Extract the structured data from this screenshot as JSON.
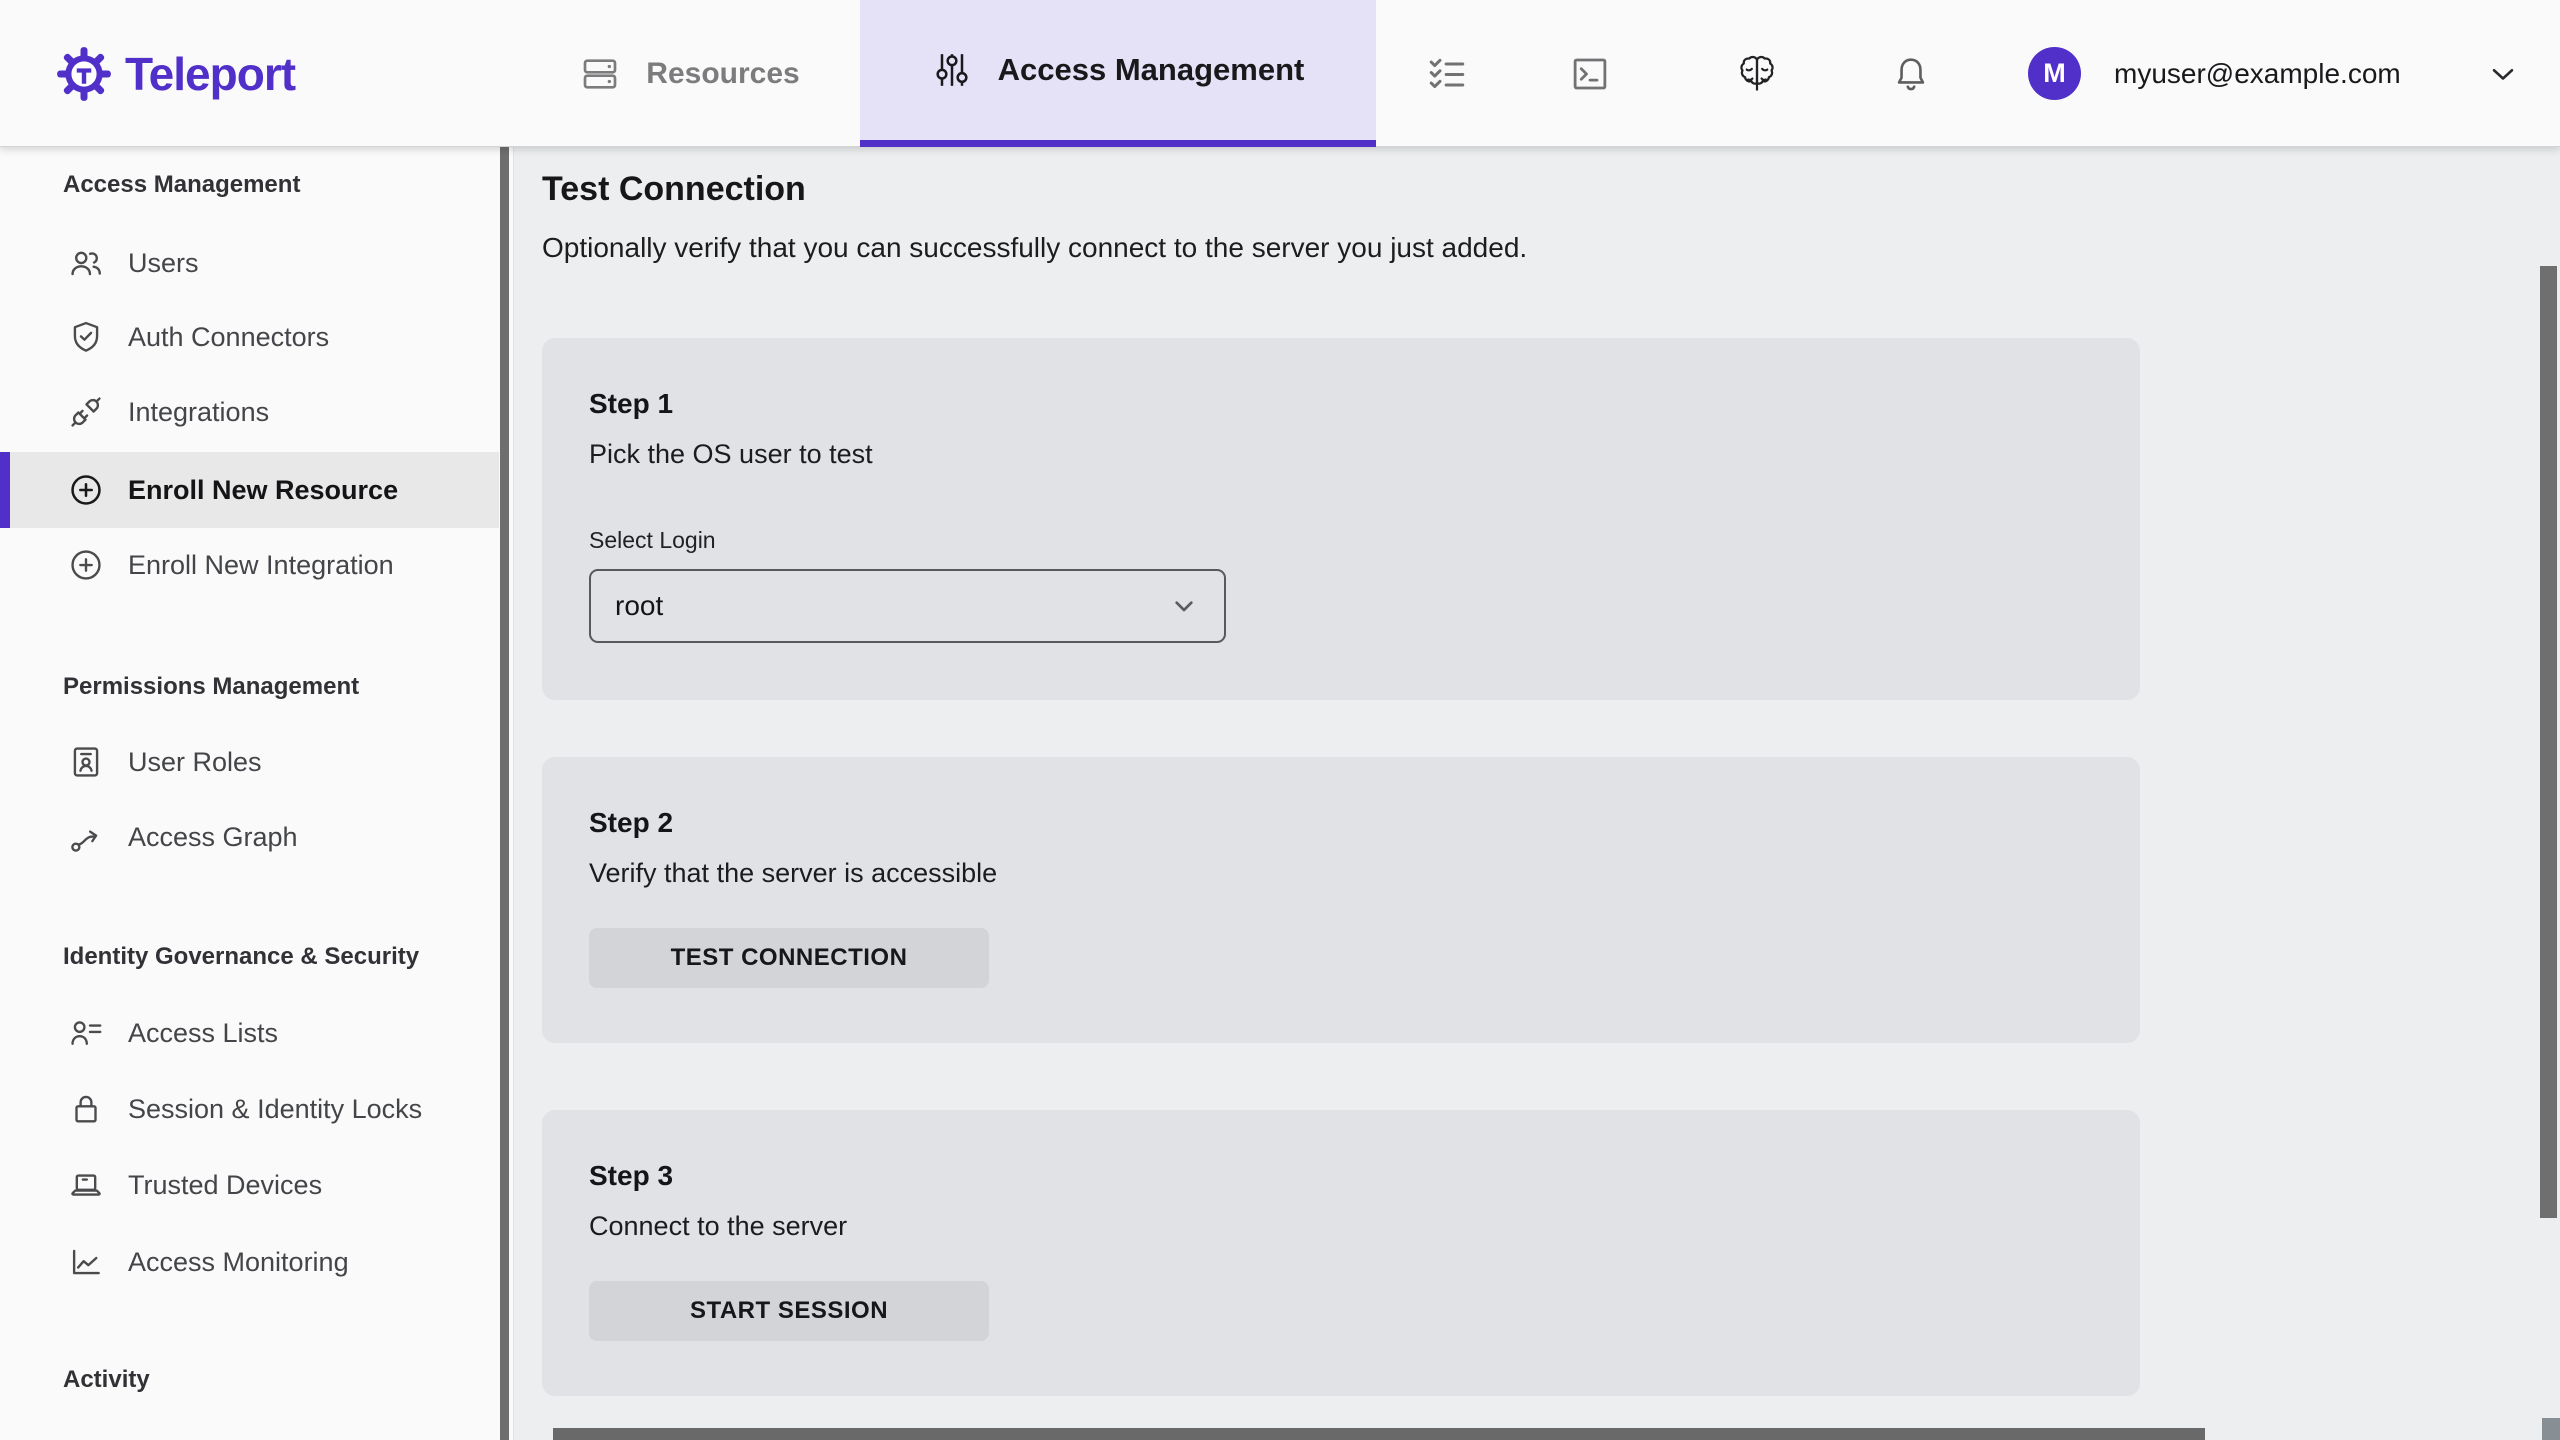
{
  "brand": {
    "name": "Teleport",
    "purple": "#512FC9"
  },
  "topnav": {
    "tabs": [
      {
        "label": "Resources",
        "icon": "servers-icon",
        "active": false
      },
      {
        "label": "Access Management",
        "icon": "sliders-icon",
        "active": true
      }
    ],
    "icon_buttons": [
      "tasks-checklist-icon",
      "terminal-icon",
      "assist-brain-icon",
      "notifications-bell-icon"
    ],
    "user": {
      "initial": "M",
      "email": "myuser@example.com"
    }
  },
  "sidebar": {
    "sections": [
      {
        "heading": "Access Management",
        "items": [
          {
            "label": "Users",
            "icon": "users-icon",
            "active": false
          },
          {
            "label": "Auth Connectors",
            "icon": "shield-check-icon",
            "active": false
          },
          {
            "label": "Integrations",
            "icon": "plug-icon",
            "active": false
          },
          {
            "label": "Enroll New Resource",
            "icon": "plus-circle-icon",
            "active": true
          },
          {
            "label": "Enroll New Integration",
            "icon": "plus-circle-icon",
            "active": false
          }
        ]
      },
      {
        "heading": "Permissions Management",
        "items": [
          {
            "label": "User Roles",
            "icon": "id-card-icon",
            "active": false
          },
          {
            "label": "Access Graph",
            "icon": "graph-arrow-icon",
            "active": false
          }
        ]
      },
      {
        "heading": "Identity Governance & Security",
        "items": [
          {
            "label": "Access Lists",
            "icon": "person-list-icon",
            "active": false
          },
          {
            "label": "Session & Identity Locks",
            "icon": "lock-icon",
            "active": false
          },
          {
            "label": "Trusted Devices",
            "icon": "laptop-icon",
            "active": false
          },
          {
            "label": "Access Monitoring",
            "icon": "chart-icon",
            "active": false
          }
        ]
      },
      {
        "heading": "Activity",
        "items": []
      }
    ]
  },
  "main": {
    "title": "Test Connection",
    "subtitle": "Optionally verify that you can successfully connect to the server you just added.",
    "steps": [
      {
        "name": "Step 1",
        "description": "Pick the OS user to test",
        "field_label": "Select Login",
        "field_value": "root"
      },
      {
        "name": "Step 2",
        "description": "Verify that the server is accessible",
        "button_label": "TEST CONNECTION"
      },
      {
        "name": "Step 3",
        "description": "Connect to the server",
        "button_label": "START SESSION"
      }
    ]
  },
  "colors": {
    "brand_purple": "#512FC9",
    "active_tab_bg": "#E5E1F7",
    "nav_bg": "#FAFAFB",
    "content_bg": "#EDEEF0",
    "card_bg": "#E1E2E5",
    "button_bg": "#D2D4D7",
    "active_item_bg": "#E8E8E9",
    "terminal_bar": "#696969",
    "scrollbar_thumb": "#6F6F6F"
  }
}
